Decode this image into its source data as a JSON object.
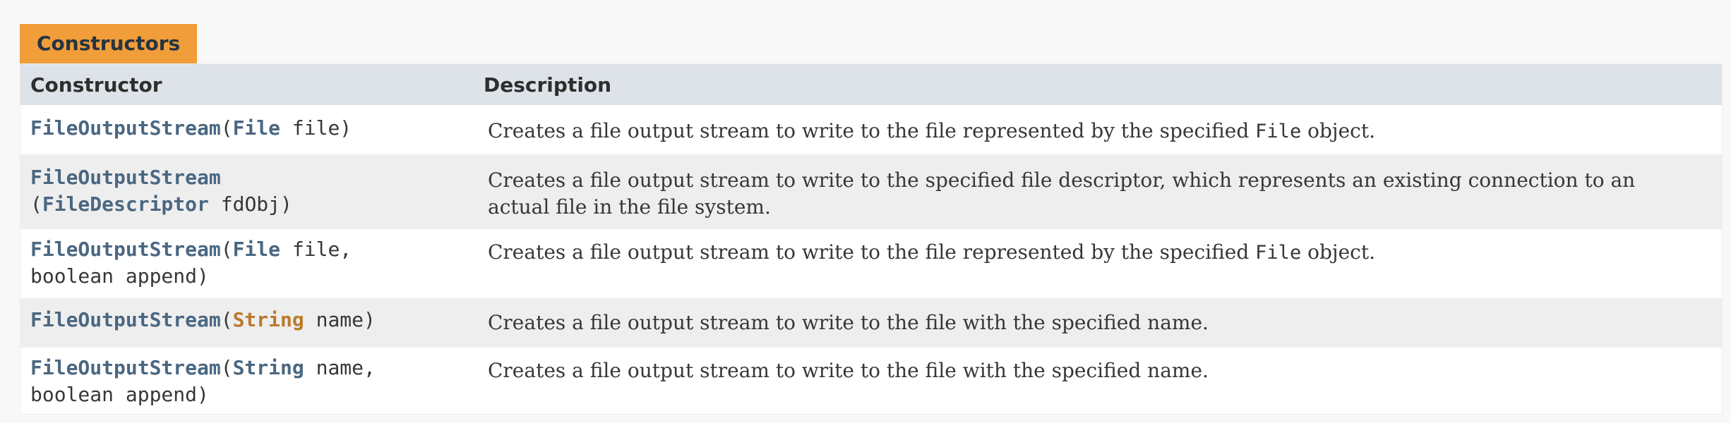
{
  "caption": "Constructors",
  "headers": {
    "constructor": "Constructor",
    "description": "Description"
  },
  "rows": [
    {
      "name": "FileOutputStream",
      "open": "(",
      "type1": "File",
      "param1": " file)",
      "line2": "",
      "desc_before": "Creates a file output stream to write to the file represented by the specified ",
      "desc_code": "File",
      "desc_after": " object."
    },
    {
      "name": "FileOutputStream",
      "line2_open": "(",
      "type1": "FileDescriptor",
      "param1": " fdObj)",
      "desc_line1": "Creates a file output stream to write to the specified file descriptor, which represents an existing connection to an",
      "desc_line2": "actual file in the file system."
    },
    {
      "name": "FileOutputStream",
      "open": "(",
      "type1": "File",
      "param1": " file,",
      "line2": "boolean append)",
      "desc_before": "Creates a file output stream to write to the file represented by the specified ",
      "desc_code": "File",
      "desc_after": " object."
    },
    {
      "name": "FileOutputStream",
      "open": "(",
      "type1": "String",
      "param1": " name)",
      "desc": "Creates a file output stream to write to the file with the specified name."
    },
    {
      "name": "FileOutputStream",
      "open": "(",
      "type1": "String",
      "param1": " name,",
      "line2": "boolean append)",
      "desc": "Creates a file output stream to write to the file with the specified name."
    }
  ],
  "colors": {
    "caption_bg": "#f09d3a",
    "header_bg": "#dee3e9",
    "link": "#4a6782",
    "link_hover": "#bb7a2a",
    "alt_row": "#eeeeee"
  }
}
